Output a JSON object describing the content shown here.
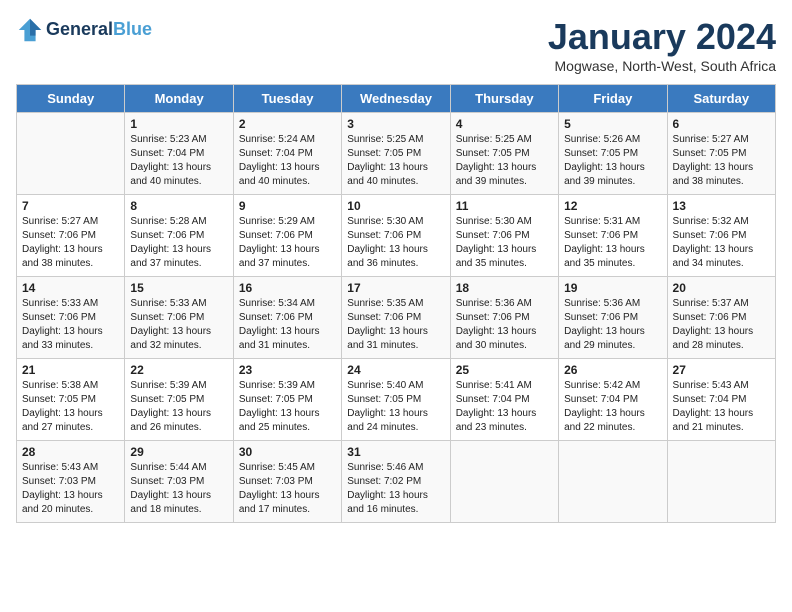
{
  "header": {
    "logo_line1": "General",
    "logo_line2": "Blue",
    "month": "January 2024",
    "location": "Mogwase, North-West, South Africa"
  },
  "weekdays": [
    "Sunday",
    "Monday",
    "Tuesday",
    "Wednesday",
    "Thursday",
    "Friday",
    "Saturday"
  ],
  "weeks": [
    [
      {
        "day": "",
        "info": ""
      },
      {
        "day": "1",
        "info": "Sunrise: 5:23 AM\nSunset: 7:04 PM\nDaylight: 13 hours\nand 40 minutes."
      },
      {
        "day": "2",
        "info": "Sunrise: 5:24 AM\nSunset: 7:04 PM\nDaylight: 13 hours\nand 40 minutes."
      },
      {
        "day": "3",
        "info": "Sunrise: 5:25 AM\nSunset: 7:05 PM\nDaylight: 13 hours\nand 40 minutes."
      },
      {
        "day": "4",
        "info": "Sunrise: 5:25 AM\nSunset: 7:05 PM\nDaylight: 13 hours\nand 39 minutes."
      },
      {
        "day": "5",
        "info": "Sunrise: 5:26 AM\nSunset: 7:05 PM\nDaylight: 13 hours\nand 39 minutes."
      },
      {
        "day": "6",
        "info": "Sunrise: 5:27 AM\nSunset: 7:05 PM\nDaylight: 13 hours\nand 38 minutes."
      }
    ],
    [
      {
        "day": "7",
        "info": "Sunrise: 5:27 AM\nSunset: 7:06 PM\nDaylight: 13 hours\nand 38 minutes."
      },
      {
        "day": "8",
        "info": "Sunrise: 5:28 AM\nSunset: 7:06 PM\nDaylight: 13 hours\nand 37 minutes."
      },
      {
        "day": "9",
        "info": "Sunrise: 5:29 AM\nSunset: 7:06 PM\nDaylight: 13 hours\nand 37 minutes."
      },
      {
        "day": "10",
        "info": "Sunrise: 5:30 AM\nSunset: 7:06 PM\nDaylight: 13 hours\nand 36 minutes."
      },
      {
        "day": "11",
        "info": "Sunrise: 5:30 AM\nSunset: 7:06 PM\nDaylight: 13 hours\nand 35 minutes."
      },
      {
        "day": "12",
        "info": "Sunrise: 5:31 AM\nSunset: 7:06 PM\nDaylight: 13 hours\nand 35 minutes."
      },
      {
        "day": "13",
        "info": "Sunrise: 5:32 AM\nSunset: 7:06 PM\nDaylight: 13 hours\nand 34 minutes."
      }
    ],
    [
      {
        "day": "14",
        "info": "Sunrise: 5:33 AM\nSunset: 7:06 PM\nDaylight: 13 hours\nand 33 minutes."
      },
      {
        "day": "15",
        "info": "Sunrise: 5:33 AM\nSunset: 7:06 PM\nDaylight: 13 hours\nand 32 minutes."
      },
      {
        "day": "16",
        "info": "Sunrise: 5:34 AM\nSunset: 7:06 PM\nDaylight: 13 hours\nand 31 minutes."
      },
      {
        "day": "17",
        "info": "Sunrise: 5:35 AM\nSunset: 7:06 PM\nDaylight: 13 hours\nand 31 minutes."
      },
      {
        "day": "18",
        "info": "Sunrise: 5:36 AM\nSunset: 7:06 PM\nDaylight: 13 hours\nand 30 minutes."
      },
      {
        "day": "19",
        "info": "Sunrise: 5:36 AM\nSunset: 7:06 PM\nDaylight: 13 hours\nand 29 minutes."
      },
      {
        "day": "20",
        "info": "Sunrise: 5:37 AM\nSunset: 7:06 PM\nDaylight: 13 hours\nand 28 minutes."
      }
    ],
    [
      {
        "day": "21",
        "info": "Sunrise: 5:38 AM\nSunset: 7:05 PM\nDaylight: 13 hours\nand 27 minutes."
      },
      {
        "day": "22",
        "info": "Sunrise: 5:39 AM\nSunset: 7:05 PM\nDaylight: 13 hours\nand 26 minutes."
      },
      {
        "day": "23",
        "info": "Sunrise: 5:39 AM\nSunset: 7:05 PM\nDaylight: 13 hours\nand 25 minutes."
      },
      {
        "day": "24",
        "info": "Sunrise: 5:40 AM\nSunset: 7:05 PM\nDaylight: 13 hours\nand 24 minutes."
      },
      {
        "day": "25",
        "info": "Sunrise: 5:41 AM\nSunset: 7:04 PM\nDaylight: 13 hours\nand 23 minutes."
      },
      {
        "day": "26",
        "info": "Sunrise: 5:42 AM\nSunset: 7:04 PM\nDaylight: 13 hours\nand 22 minutes."
      },
      {
        "day": "27",
        "info": "Sunrise: 5:43 AM\nSunset: 7:04 PM\nDaylight: 13 hours\nand 21 minutes."
      }
    ],
    [
      {
        "day": "28",
        "info": "Sunrise: 5:43 AM\nSunset: 7:03 PM\nDaylight: 13 hours\nand 20 minutes."
      },
      {
        "day": "29",
        "info": "Sunrise: 5:44 AM\nSunset: 7:03 PM\nDaylight: 13 hours\nand 18 minutes."
      },
      {
        "day": "30",
        "info": "Sunrise: 5:45 AM\nSunset: 7:03 PM\nDaylight: 13 hours\nand 17 minutes."
      },
      {
        "day": "31",
        "info": "Sunrise: 5:46 AM\nSunset: 7:02 PM\nDaylight: 13 hours\nand 16 minutes."
      },
      {
        "day": "",
        "info": ""
      },
      {
        "day": "",
        "info": ""
      },
      {
        "day": "",
        "info": ""
      }
    ]
  ]
}
